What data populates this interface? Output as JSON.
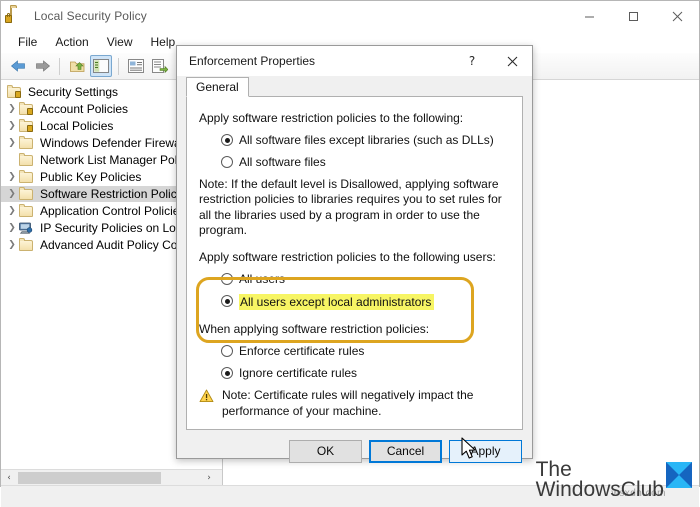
{
  "window": {
    "title": "Local Security Policy",
    "app_icon": "security-policy-lock-folder-icon",
    "controls": {
      "minimize": "–",
      "maximize": "☐",
      "close": "✕"
    }
  },
  "menubar": {
    "items": [
      {
        "label": "File"
      },
      {
        "label": "Action"
      },
      {
        "label": "View"
      },
      {
        "label": "Help"
      }
    ]
  },
  "toolbar": {
    "buttons": [
      {
        "name": "back-arrow-icon"
      },
      {
        "name": "forward-arrow-icon"
      },
      {
        "name": "up-one-level-folder-icon"
      },
      {
        "name": "show-hide-console-tree-icon"
      },
      {
        "name": "properties-icon"
      },
      {
        "name": "export-list-icon"
      },
      {
        "name": "help-icon"
      }
    ]
  },
  "tree": {
    "root": {
      "label": "Security Settings",
      "icon": "lock-folder-icon"
    },
    "items": [
      {
        "label": "Account Policies",
        "icon": "locked-folder-icon",
        "expandable": true,
        "selected": false
      },
      {
        "label": "Local Policies",
        "icon": "locked-folder-icon",
        "expandable": true,
        "selected": false
      },
      {
        "label": "Windows Defender Firewall",
        "icon": "folder-icon",
        "expandable": true,
        "selected": false
      },
      {
        "label": "Network List Manager Polic",
        "icon": "folder-icon",
        "expandable": false,
        "selected": false
      },
      {
        "label": "Public Key Policies",
        "icon": "folder-icon",
        "expandable": true,
        "selected": false
      },
      {
        "label": "Software Restriction Policies",
        "icon": "folder-icon",
        "expandable": true,
        "selected": true
      },
      {
        "label": "Application Control Policies",
        "icon": "folder-icon",
        "expandable": true,
        "selected": false
      },
      {
        "label": "IP Security Policies on Local",
        "icon": "network-policy-icon",
        "expandable": true,
        "selected": false
      },
      {
        "label": "Advanced Audit Policy Con",
        "icon": "folder-icon",
        "expandable": true,
        "selected": false
      }
    ],
    "scrollbar": {
      "left_arrow": "‹",
      "right_arrow": "›"
    }
  },
  "dialog": {
    "title": "Enforcement Properties",
    "help_label": "?",
    "close_label": "✕",
    "tabs": [
      {
        "label": "General",
        "active": true
      }
    ],
    "section_files": {
      "label": "Apply software restriction policies to the following:",
      "options": [
        {
          "label": "All software files except libraries (such as DLLs)",
          "checked": true
        },
        {
          "label": "All software files",
          "checked": false
        }
      ],
      "note": "Note:  If the default level is Disallowed, applying software restriction policies to libraries requires you to set rules for all the libraries used by a program in order to use the program."
    },
    "section_users": {
      "label": "Apply software restriction policies to the following users:",
      "options": [
        {
          "label": "All users",
          "checked": false,
          "highlighted": false
        },
        {
          "label": "All users except local administrators",
          "checked": true,
          "highlighted": true
        }
      ]
    },
    "section_certificates": {
      "label": "When applying software restriction policies:",
      "options": [
        {
          "label": "Enforce certificate rules",
          "checked": false
        },
        {
          "label": "Ignore certificate rules",
          "checked": true
        }
      ],
      "note": "Note:  Certificate rules will negatively impact the performance of your machine.",
      "note_icon": "warning-triangle-icon"
    },
    "buttons": [
      {
        "label": "OK",
        "state": "normal"
      },
      {
        "label": "Cancel",
        "state": "focused"
      },
      {
        "label": "Apply",
        "state": "hovered"
      }
    ]
  },
  "highlight": {
    "border_color": "#dda520",
    "fill_color": "#f7f564"
  },
  "watermark": {
    "line1": "The",
    "line2": "WindowsClub",
    "sub": "wsxdn.com",
    "logo_color": "#2196f3"
  }
}
